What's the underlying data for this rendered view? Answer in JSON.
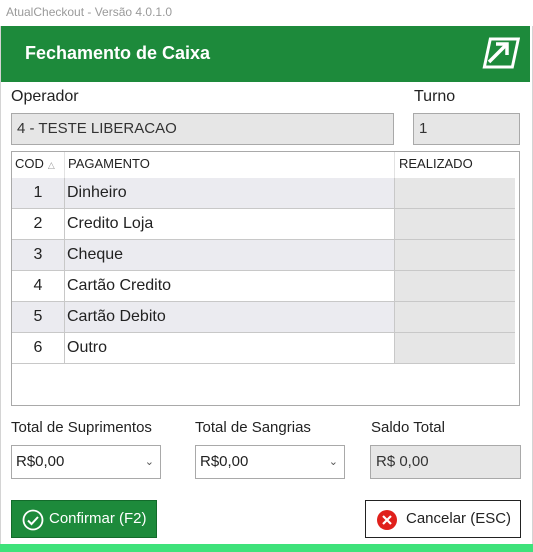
{
  "app": {
    "window_title": "AtualCheckout - Versão 4.0.1.0"
  },
  "header": {
    "title": "Fechamento de Caixa",
    "logo_icon": "arrow-logo-icon"
  },
  "operator": {
    "label": "Operador",
    "value": "4 - TESTE LIBERACAO"
  },
  "shift": {
    "label": "Turno",
    "value": "1"
  },
  "grid": {
    "columns": {
      "cod": "COD",
      "pagamento": "PAGAMENTO",
      "realizado": "REALIZADO"
    },
    "sort_indicator": "△",
    "rows": [
      {
        "cod": "1",
        "pagamento": "Dinheiro",
        "realizado": ""
      },
      {
        "cod": "2",
        "pagamento": "Credito Loja",
        "realizado": ""
      },
      {
        "cod": "3",
        "pagamento": "Cheque",
        "realizado": ""
      },
      {
        "cod": "4",
        "pagamento": "Cartão Credito",
        "realizado": ""
      },
      {
        "cod": "5",
        "pagamento": "Cartão Debito",
        "realizado": ""
      },
      {
        "cod": "6",
        "pagamento": "Outro",
        "realizado": ""
      }
    ]
  },
  "totals": {
    "suprimentos": {
      "label": "Total de Suprimentos",
      "value": "R$0,00"
    },
    "sangrias": {
      "label": "Total de Sangrias",
      "value": "R$0,00"
    },
    "saldo": {
      "label": "Saldo Total",
      "value": "R$ 0,00"
    }
  },
  "buttons": {
    "confirm": {
      "label": "Confirmar (F2)",
      "icon": "check-circle-icon"
    },
    "cancel": {
      "label": "Cancelar (ESC)",
      "icon": "close-circle-icon"
    }
  },
  "colors": {
    "brand": "#1d8a3b",
    "accent_bar": "#3ee27a",
    "cancel_icon": "#e0201b"
  }
}
